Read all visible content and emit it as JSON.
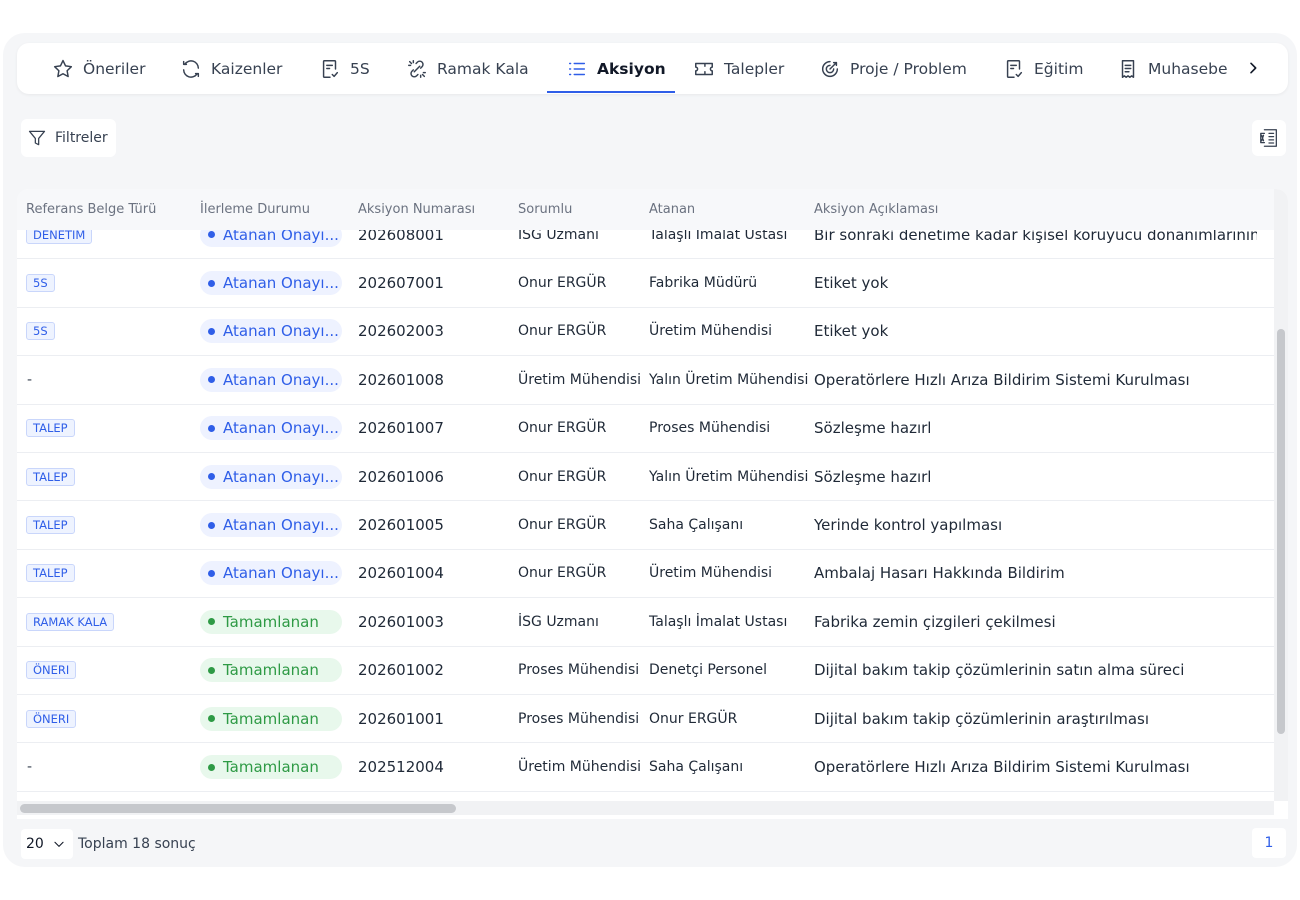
{
  "tabs": [
    {
      "label": "Öneriler",
      "icon": "star-icon"
    },
    {
      "label": "Kaizenler",
      "icon": "refresh-icon"
    },
    {
      "label": "5S",
      "icon": "clipboard-icon"
    },
    {
      "label": "Ramak Kala",
      "icon": "broken-link-icon"
    },
    {
      "label": "Aksiyon",
      "icon": "list-icon",
      "active": true
    },
    {
      "label": "Talepler",
      "icon": "ticket-icon"
    },
    {
      "label": "Proje / Problem",
      "icon": "target-icon"
    },
    {
      "label": "Eğitim",
      "icon": "clipboard-icon"
    },
    {
      "label": "Muhasebe",
      "icon": "receipt-icon"
    }
  ],
  "toolbar": {
    "filter_label": "Filtreler"
  },
  "table": {
    "columns": [
      "Referans Belge Türü",
      "İlerleme Durumu",
      "Aksiyon Numarası",
      "Sorumlu",
      "Atanan",
      "Aksiyon Açıklaması"
    ],
    "rows": [
      {
        "ref": "DENETIM",
        "status": "Atanan Onayı...",
        "status_type": "blue",
        "number": "202608001",
        "responsible": "İSG Uzmanı",
        "assignee": "Talaşlı İmalat Ustası",
        "description": "Bir sonraki denetime kadar kişisel koruyucu donanımlarının eksik"
      },
      {
        "ref": "5S",
        "status": "Atanan Onayı...",
        "status_type": "blue",
        "number": "202607001",
        "responsible": "Onur ERGÜR",
        "assignee": "Fabrika Müdürü",
        "description": "Etiket yok"
      },
      {
        "ref": "5S",
        "status": "Atanan Onayı...",
        "status_type": "blue",
        "number": "202602003",
        "responsible": "Onur ERGÜR",
        "assignee": "Üretim Mühendisi",
        "description": "Etiket yok"
      },
      {
        "ref": "-",
        "status": "Atanan Onayı...",
        "status_type": "blue",
        "number": "202601008",
        "responsible": "Üretim Mühendisi",
        "assignee": "Yalın Üretim Mühendisi",
        "description": "Operatörlere Hızlı Arıza Bildirim Sistemi Kurulması"
      },
      {
        "ref": "TALEP",
        "status": "Atanan Onayı...",
        "status_type": "blue",
        "number": "202601007",
        "responsible": "Onur ERGÜR",
        "assignee": "Proses Mühendisi",
        "description": "Sözleşme hazırl"
      },
      {
        "ref": "TALEP",
        "status": "Atanan Onayı...",
        "status_type": "blue",
        "number": "202601006",
        "responsible": "Onur ERGÜR",
        "assignee": "Yalın Üretim Mühendisi",
        "description": "Sözleşme hazırl"
      },
      {
        "ref": "TALEP",
        "status": "Atanan Onayı...",
        "status_type": "blue",
        "number": "202601005",
        "responsible": "Onur ERGÜR",
        "assignee": "Saha Çalışanı",
        "description": "Yerinde kontrol yapılması"
      },
      {
        "ref": "TALEP",
        "status": "Atanan Onayı...",
        "status_type": "blue",
        "number": "202601004",
        "responsible": "Onur ERGÜR",
        "assignee": "Üretim Mühendisi",
        "description": "Ambalaj Hasarı Hakkında Bildirim"
      },
      {
        "ref": "RAMAK KALA",
        "status": "Tamamlanan",
        "status_type": "green",
        "number": "202601003",
        "responsible": "İSG Uzmanı",
        "assignee": "Talaşlı İmalat Ustası",
        "description": "Fabrika zemin çizgileri çekilmesi"
      },
      {
        "ref": "ÖNERI",
        "status": "Tamamlanan",
        "status_type": "green",
        "number": "202601002",
        "responsible": "Proses Mühendisi",
        "assignee": "Denetçi Personel",
        "description": "Dijital bakım takip çözümlerinin satın alma süreci"
      },
      {
        "ref": "ÖNERI",
        "status": "Tamamlanan",
        "status_type": "green",
        "number": "202601001",
        "responsible": "Proses Mühendisi",
        "assignee": "Onur ERGÜR",
        "description": "Dijital bakım takip çözümlerinin araştırılması"
      },
      {
        "ref": "-",
        "status": "Tamamlanan",
        "status_type": "green",
        "number": "202512004",
        "responsible": "Üretim Mühendisi",
        "assignee": "Saha Çalışanı",
        "description": "Operatörlere Hızlı Arıza Bildirim Sistemi Kurulması"
      }
    ]
  },
  "pagination": {
    "page_size": "20",
    "total_label": "Toplam 18 sonuç",
    "current_page": "1"
  },
  "colors": {
    "accent": "#2f5ee8",
    "success": "#2e9a45"
  }
}
